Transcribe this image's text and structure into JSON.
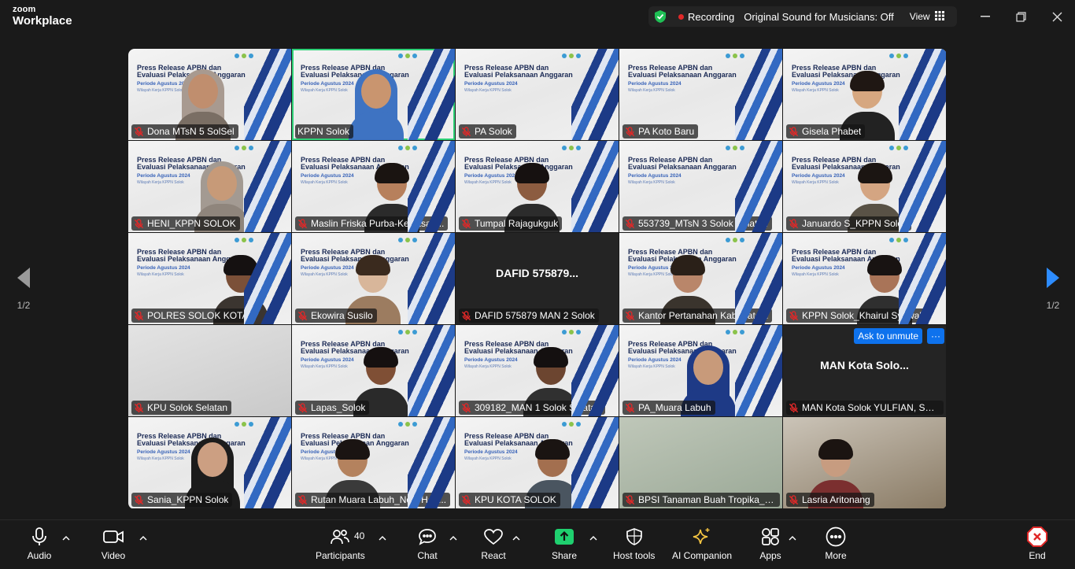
{
  "app": {
    "brand_top": "zoom",
    "brand_bottom": "Workplace"
  },
  "status": {
    "recording_label": "Recording",
    "sound_label": "Original Sound for Musicians: Off",
    "view_label": "View"
  },
  "slide": {
    "title_line1": "Press Release APBN dan",
    "title_line2": "Evaluasi Pelaksanaan Anggaran",
    "period": "Periode Agustus 2024",
    "region": "Wilayah Kerja KPPN Solok"
  },
  "participants": [
    {
      "name": "Dona MTsN 5 SolSel",
      "muted": true
    },
    {
      "name": "KPPN Solok",
      "muted": false,
      "active": true
    },
    {
      "name": "PA Solok",
      "muted": true
    },
    {
      "name": "PA Koto Baru",
      "muted": true
    },
    {
      "name": "Gisela Phabet",
      "muted": true
    },
    {
      "name": "HENI_KPPN SOLOK",
      "muted": true
    },
    {
      "name": "Maslin Friska Purba-Kejaksaa...",
      "muted": true
    },
    {
      "name": "Tumpal Rajagukguk",
      "muted": true
    },
    {
      "name": "553739_MTsN 3 Solok Selatan",
      "muted": true
    },
    {
      "name": "Januardo S_KPPN Solok",
      "muted": true
    },
    {
      "name": "POLRES SOLOK KOTA",
      "muted": true
    },
    {
      "name": "Ekowira Susilo",
      "muted": true
    },
    {
      "name": "DAFID 575879 MAN 2 Solok",
      "muted": true,
      "display_name": "DAFID 575879..."
    },
    {
      "name": "Kantor Pertanahan Kabupate...",
      "muted": true
    },
    {
      "name": "KPPN Solok_Khairul Syawal",
      "muted": true
    },
    {
      "name": "KPU Solok Selatan",
      "muted": true
    },
    {
      "name": "Lapas_Solok",
      "muted": true
    },
    {
      "name": "309182_MAN 1 Solok Selatan",
      "muted": true
    },
    {
      "name": "PA_Muara Labuh",
      "muted": true
    },
    {
      "name": "MAN Kota Solok YULFIAN, SH...",
      "muted": true,
      "display_name": "MAN Kota Solo...",
      "ask_unmute": "Ask to unmute",
      "more": "···"
    },
    {
      "name": "Sania_KPPN Solok",
      "muted": true
    },
    {
      "name": "Rutan Muara Labuh_Novi Hen...",
      "muted": true
    },
    {
      "name": "KPU KOTA SOLOK",
      "muted": true
    },
    {
      "name": "BPSI Tanaman Buah Tropika_D...",
      "muted": true
    },
    {
      "name": "Lasria Aritonang",
      "muted": true
    }
  ],
  "pagination": {
    "left": "1/2",
    "right": "1/2"
  },
  "toolbar": {
    "audio": "Audio",
    "video": "Video",
    "participants": "Participants",
    "participants_count": "40",
    "chat": "Chat",
    "react": "React",
    "share": "Share",
    "host_tools": "Host tools",
    "ai_companion": "AI Companion",
    "apps": "Apps",
    "more": "More",
    "end": "End"
  },
  "colors": {
    "accent": "#0e72ed",
    "active_border": "#2fd278",
    "share_green": "#1fd06f",
    "end_red": "#e02828"
  }
}
